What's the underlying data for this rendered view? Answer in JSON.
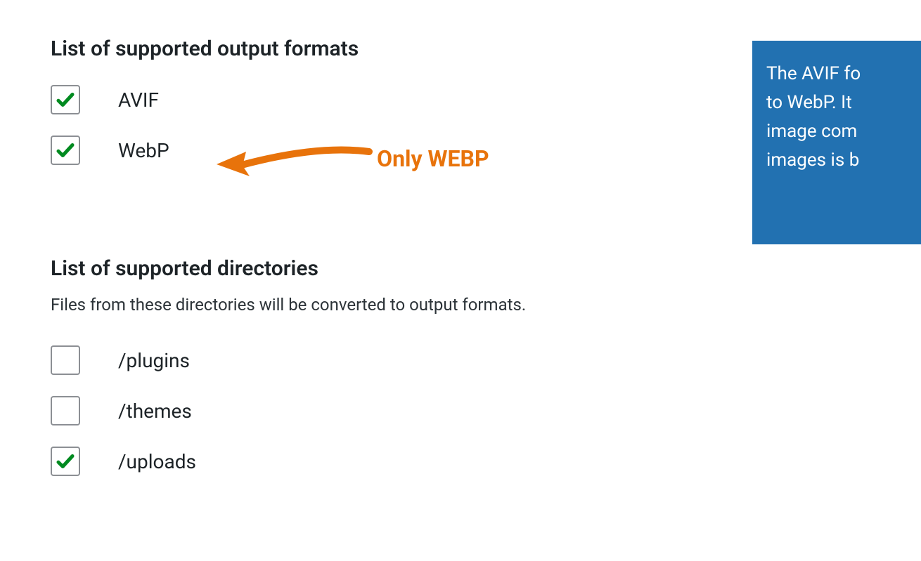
{
  "formats": {
    "heading": "List of supported output formats",
    "items": [
      {
        "label": "AVIF",
        "checked": true
      },
      {
        "label": "WebP",
        "checked": true
      }
    ]
  },
  "directories": {
    "heading": "List of supported directories",
    "description": "Files from these directories will be converted to output formats.",
    "items": [
      {
        "label": "/plugins",
        "checked": false
      },
      {
        "label": "/themes",
        "checked": false
      },
      {
        "label": "/uploads",
        "checked": true
      }
    ]
  },
  "annotation": {
    "text": "Only WEBP",
    "color": "#e8730b"
  },
  "info_box": {
    "lines": [
      "The AVIF fo",
      "to WebP. It",
      "image com",
      "images is b"
    ],
    "background": "#2271b1"
  }
}
